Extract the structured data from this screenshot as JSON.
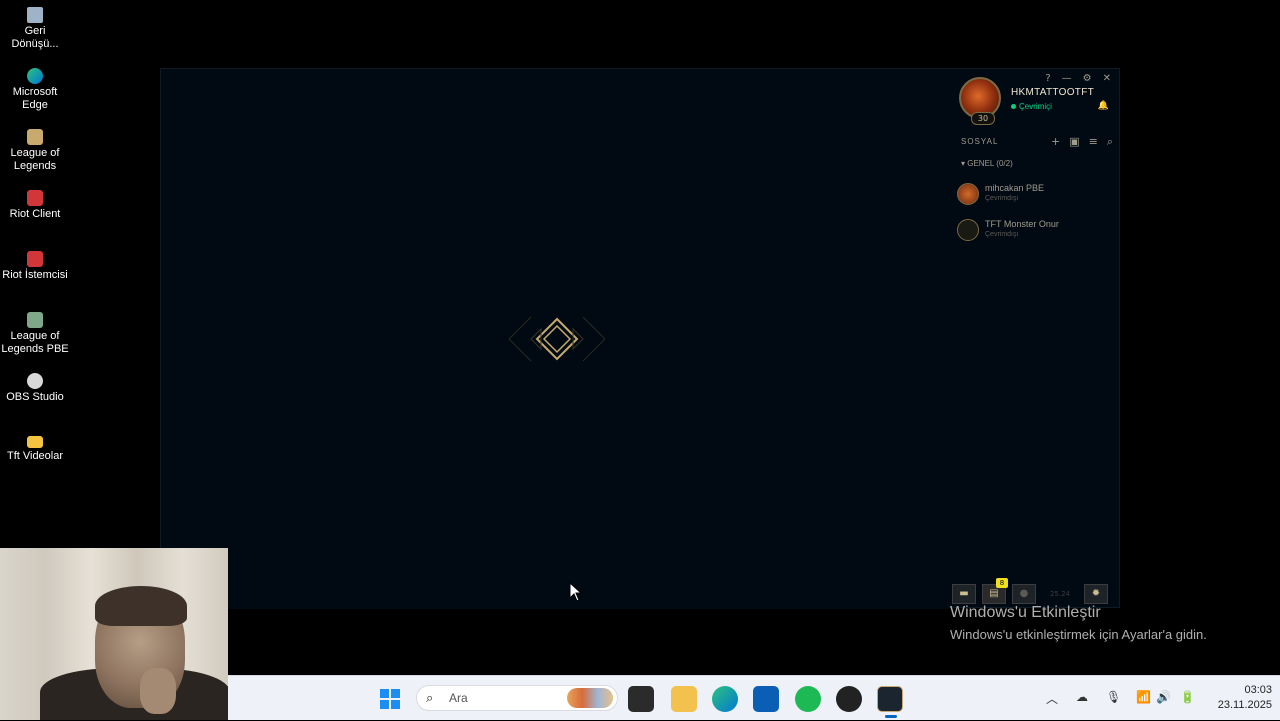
{
  "desktop_icons": [
    {
      "label": "Geri Dönüşü...",
      "icon": "recycle-bin-icon"
    },
    {
      "label": "Microsoft Edge",
      "icon": "edge-icon"
    },
    {
      "label": "League of Legends",
      "icon": "league-icon"
    },
    {
      "label": "Riot Client",
      "icon": "riot-client-icon"
    },
    {
      "label": "Riot İstemcisi",
      "icon": "riot-client-icon"
    },
    {
      "label": "League of Legends PBE",
      "icon": "league-pbe-icon"
    },
    {
      "label": "OBS Studio",
      "icon": "obs-icon"
    },
    {
      "label": "Tft Videolar",
      "icon": "folder-icon"
    }
  ],
  "client": {
    "window_controls": [
      "?",
      "—",
      "⚙",
      "✕"
    ],
    "summoner": {
      "name": "HKMTATTOOTFT",
      "status": "Çevrimiçi",
      "level": "30"
    },
    "social": {
      "label": "SOSYAL",
      "group": "GENEL (0/2)",
      "friends": [
        {
          "name": "mihcakan PBE",
          "status": "Çevrimdışı"
        },
        {
          "name": "TFT Monster Onur",
          "status": "Çevrimdışı"
        }
      ]
    },
    "bottom_badge": "8",
    "version": "25.24"
  },
  "watermark": {
    "title": "Windows'u Etkinleştir",
    "subtitle": "Windows'u etkinleştirmek için Ayarlar'a gidin."
  },
  "taskbar": {
    "search_placeholder": "Ara",
    "clock_time": "03:03",
    "clock_date": "23.11.2025"
  },
  "colors": {
    "client_bg": "#010a13",
    "gold": "#c8aa6e",
    "online": "#0acf83",
    "taskbar_bg": "#eef2f8"
  }
}
